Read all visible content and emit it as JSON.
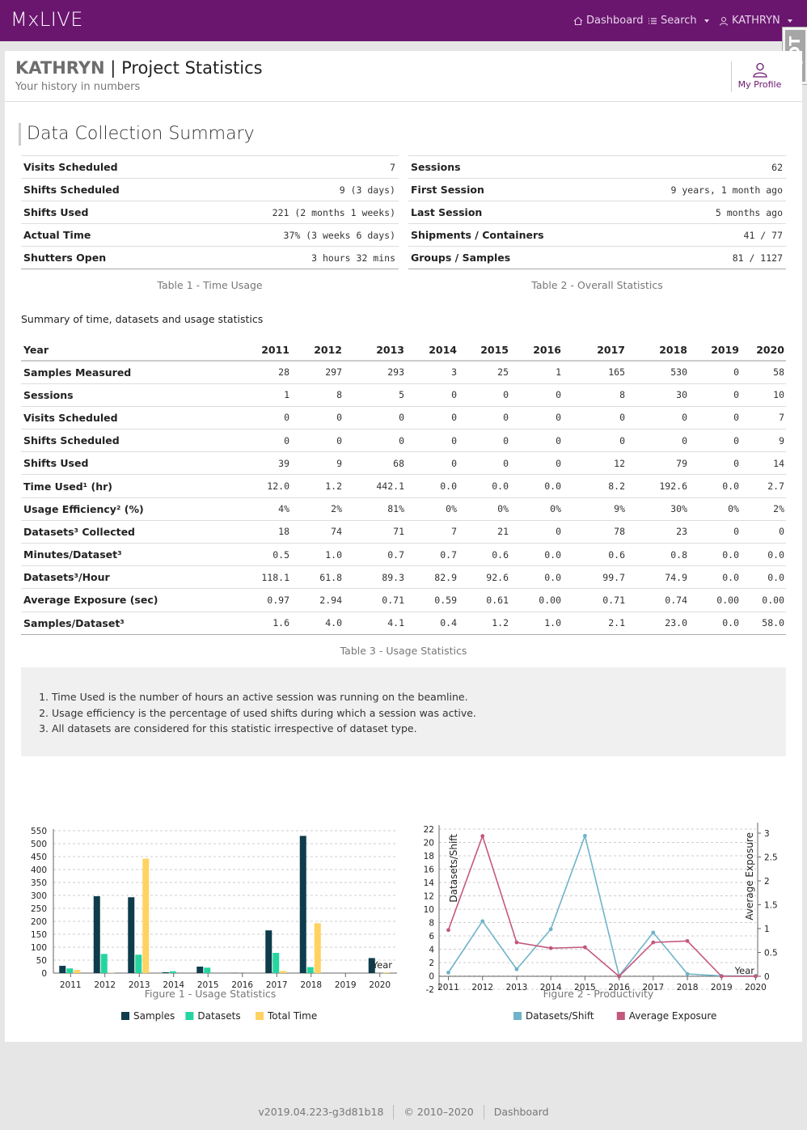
{
  "nav": {
    "brand": "MxLIVE",
    "dashboard": "Dashboard",
    "search": "Search",
    "user": "KATHRYN",
    "debug": "DjDT"
  },
  "header": {
    "user": "KATHRYN",
    "separator": "|",
    "title": "Project Statistics",
    "subtitle": "Your history in numbers",
    "profile_label": "My Profile"
  },
  "section_title": "Data Collection Summary",
  "time_usage": {
    "caption": "Table 1 - Time Usage",
    "rows": [
      {
        "label": "Visits Scheduled",
        "value": "7"
      },
      {
        "label": "Shifts Scheduled",
        "value": "9 (3 days)"
      },
      {
        "label": "Shifts Used",
        "value": "221 (2 months 1 weeks)"
      },
      {
        "label": "Actual Time",
        "value": "37% (3 weeks 6 days)"
      },
      {
        "label": "Shutters Open",
        "value": "3 hours 32 mins"
      }
    ]
  },
  "overall": {
    "caption": "Table 2 - Overall Statistics",
    "rows": [
      {
        "label": "Sessions",
        "value": "62"
      },
      {
        "label": "First Session",
        "value": "9 years, 1 month ago"
      },
      {
        "label": "Last Session",
        "value": "5 months ago"
      },
      {
        "label": "Shipments / Containers",
        "value": "41 / 77"
      },
      {
        "label": "Groups / Samples",
        "value": "81 / 1127"
      }
    ]
  },
  "usage": {
    "summary_label": "Summary of time, datasets and usage statistics",
    "caption": "Table 3 - Usage Statistics",
    "header": [
      "Year",
      "2011",
      "2012",
      "2013",
      "2014",
      "2015",
      "2016",
      "2017",
      "2018",
      "2019",
      "2020"
    ],
    "rows": [
      [
        "Samples Measured",
        "28",
        "297",
        "293",
        "3",
        "25",
        "1",
        "165",
        "530",
        "0",
        "58"
      ],
      [
        "Sessions",
        "1",
        "8",
        "5",
        "0",
        "0",
        "0",
        "8",
        "30",
        "0",
        "10"
      ],
      [
        "Visits Scheduled",
        "0",
        "0",
        "0",
        "0",
        "0",
        "0",
        "0",
        "0",
        "0",
        "7"
      ],
      [
        "Shifts Scheduled",
        "0",
        "0",
        "0",
        "0",
        "0",
        "0",
        "0",
        "0",
        "0",
        "9"
      ],
      [
        "Shifts Used",
        "39",
        "9",
        "68",
        "0",
        "0",
        "0",
        "12",
        "79",
        "0",
        "14"
      ],
      [
        "Time Used¹ (hr)",
        "12.0",
        "1.2",
        "442.1",
        "0.0",
        "0.0",
        "0.0",
        "8.2",
        "192.6",
        "0.0",
        "2.7"
      ],
      [
        "Usage Efficiency² (%)",
        "4%",
        "2%",
        "81%",
        "0%",
        "0%",
        "0%",
        "9%",
        "30%",
        "0%",
        "2%"
      ],
      [
        "Datasets³ Collected",
        "18",
        "74",
        "71",
        "7",
        "21",
        "0",
        "78",
        "23",
        "0",
        "0"
      ],
      [
        "Minutes/Dataset³",
        "0.5",
        "1.0",
        "0.7",
        "0.7",
        "0.6",
        "0.0",
        "0.6",
        "0.8",
        "0.0",
        "0.0"
      ],
      [
        "Datasets³/Hour",
        "118.1",
        "61.8",
        "89.3",
        "82.9",
        "92.6",
        "0.0",
        "99.7",
        "74.9",
        "0.0",
        "0.0"
      ],
      [
        "Average Exposure (sec)",
        "0.97",
        "2.94",
        "0.71",
        "0.59",
        "0.61",
        "0.00",
        "0.71",
        "0.74",
        "0.00",
        "0.00"
      ],
      [
        "Samples/Dataset³",
        "1.6",
        "4.0",
        "4.1",
        "0.4",
        "1.2",
        "1.0",
        "2.1",
        "23.0",
        "0.0",
        "58.0"
      ]
    ]
  },
  "notes": [
    "Time Used is the number of hours an active session was running on the beamline.",
    "Usage efficiency is the percentage of used shifts during which a session was active.",
    "All datasets are considered for this statistic irrespective of dataset type."
  ],
  "chart_data": [
    {
      "type": "bar",
      "caption": "Figure 1 - Usage Statistics",
      "categories": [
        "2011",
        "2012",
        "2013",
        "2014",
        "2015",
        "2016",
        "2017",
        "2018",
        "2019",
        "2020"
      ],
      "xlabel": "Year",
      "ylim": [
        0,
        550
      ],
      "yticks": [
        0,
        50,
        100,
        150,
        200,
        250,
        300,
        350,
        400,
        450,
        500,
        550
      ],
      "grid": true,
      "legend_position": "bottom",
      "series": [
        {
          "name": "Samples",
          "color": "#0e3c4b",
          "values": [
            28,
            297,
            293,
            3,
            25,
            1,
            165,
            530,
            0,
            58
          ]
        },
        {
          "name": "Datasets",
          "color": "#25d5a0",
          "values": [
            18,
            74,
            71,
            7,
            21,
            0,
            78,
            23,
            0,
            0
          ]
        },
        {
          "name": "Total Time",
          "color": "#ffd262",
          "values": [
            12.0,
            1.2,
            442.1,
            0.0,
            0.0,
            0.0,
            8.2,
            192.6,
            0.0,
            2.7
          ]
        }
      ]
    },
    {
      "type": "line",
      "caption": "Figure 2 - Productivity",
      "x": [
        "2011",
        "2012",
        "2013",
        "2014",
        "2015",
        "2016",
        "2017",
        "2018",
        "2019",
        "2020"
      ],
      "xlabel": "Year",
      "ylabel_left": "Datasets/Shift",
      "ylabel_right": "Average Exposure",
      "ylim_left": [
        -2,
        22
      ],
      "yticks_left": [
        -2,
        0,
        2,
        4,
        6,
        8,
        10,
        12,
        14,
        16,
        18,
        20,
        22
      ],
      "ylim_right": [
        0,
        3
      ],
      "yticks_right": [
        0,
        0.5,
        1,
        1.5,
        2,
        2.5,
        3
      ],
      "grid": true,
      "legend_position": "bottom",
      "series": [
        {
          "name": "Datasets/Shift",
          "axis": "left",
          "color": "#6fb3c9",
          "values": [
            0.5,
            8.2,
            1.0,
            7.0,
            21.0,
            0.0,
            6.5,
            0.3,
            0.0,
            0.0
          ]
        },
        {
          "name": "Average Exposure",
          "axis": "right",
          "color": "#c4587b",
          "values": [
            0.97,
            2.94,
            0.71,
            0.59,
            0.61,
            0.0,
            0.71,
            0.74,
            0.0,
            0.0
          ]
        }
      ]
    }
  ],
  "footer": {
    "version": "v2019.04.223-g3d81b18",
    "copyright": "© 2010–2020",
    "link": "Dashboard"
  }
}
